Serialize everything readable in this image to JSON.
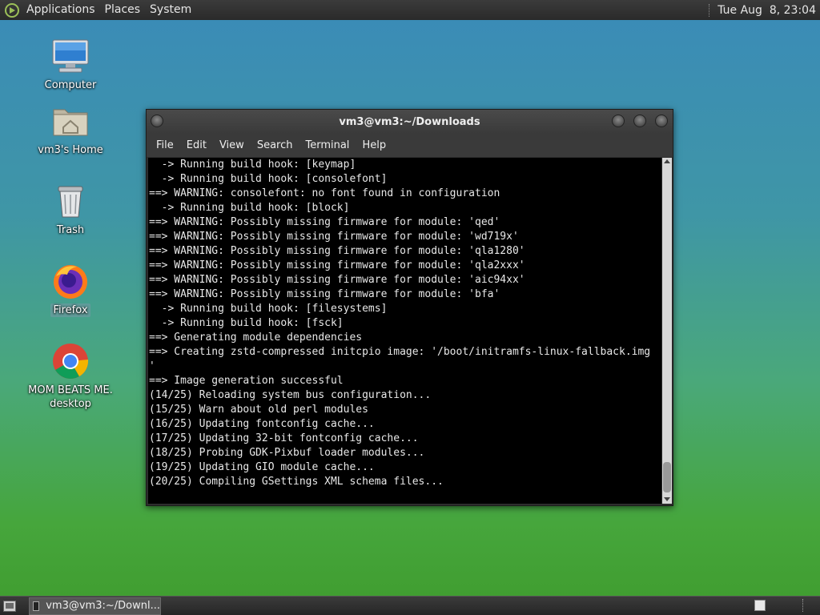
{
  "top_panel": {
    "menus": [
      "Applications",
      "Places",
      "System"
    ],
    "clock": "Tue Aug  8, 23:04"
  },
  "desktop_icons": [
    {
      "label": "Computer",
      "icon": "computer-icon"
    },
    {
      "label": "vm3's Home",
      "icon": "home-folder-icon"
    },
    {
      "label": "Trash",
      "icon": "trash-icon"
    },
    {
      "label": "Firefox",
      "icon": "firefox-icon"
    },
    {
      "label": "MOM BEATS ME.\ndesktop",
      "icon": "chrome-icon"
    }
  ],
  "terminal": {
    "title": "vm3@vm3:~/Downloads",
    "menu": [
      "File",
      "Edit",
      "View",
      "Search",
      "Terminal",
      "Help"
    ],
    "lines": [
      "  -> Running build hook: [keymap]",
      "  -> Running build hook: [consolefont]",
      "==> WARNING: consolefont: no font found in configuration",
      "  -> Running build hook: [block]",
      "==> WARNING: Possibly missing firmware for module: 'qed'",
      "==> WARNING: Possibly missing firmware for module: 'wd719x'",
      "==> WARNING: Possibly missing firmware for module: 'qla1280'",
      "==> WARNING: Possibly missing firmware for module: 'qla2xxx'",
      "==> WARNING: Possibly missing firmware for module: 'aic94xx'",
      "==> WARNING: Possibly missing firmware for module: 'bfa'",
      "  -> Running build hook: [filesystems]",
      "  -> Running build hook: [fsck]",
      "==> Generating module dependencies",
      "==> Creating zstd-compressed initcpio image: '/boot/initramfs-linux-fallback.img",
      "'",
      "==> Image generation successful",
      "(14/25) Reloading system bus configuration...",
      "(15/25) Warn about old perl modules",
      "(16/25) Updating fontconfig cache...",
      "(17/25) Updating 32-bit fontconfig cache...",
      "(18/25) Probing GDK-Pixbuf loader modules...",
      "(19/25) Updating GIO module cache...",
      "(20/25) Compiling GSettings XML schema files..."
    ]
  },
  "taskbar": {
    "task_label": "vm3@vm3:~/Downl..."
  },
  "colors": {
    "panel": "#2e2e2e",
    "terminal_bg": "#000000",
    "terminal_fg": "#e8e8e8"
  }
}
